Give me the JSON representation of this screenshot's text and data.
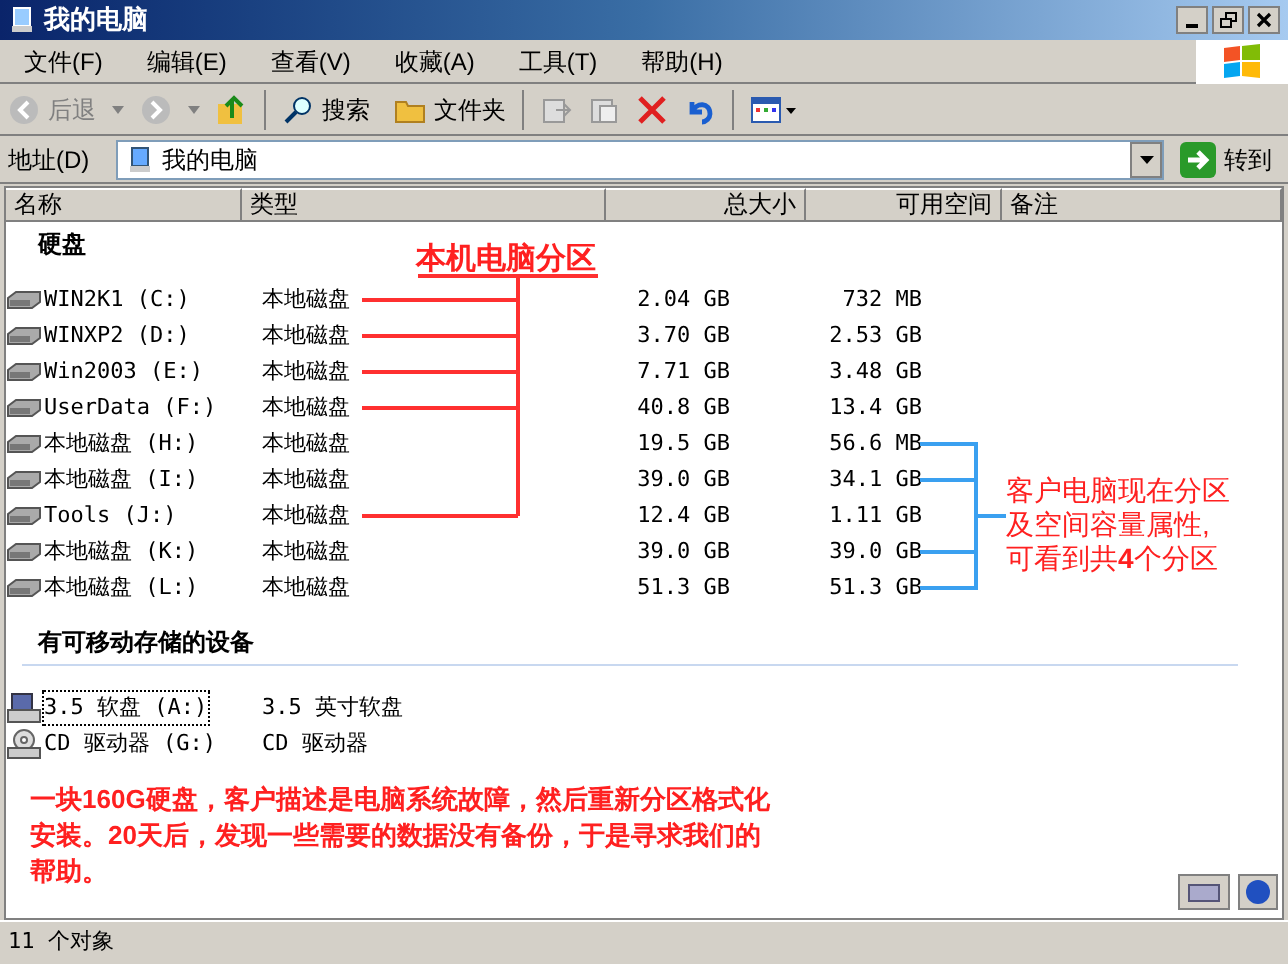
{
  "window": {
    "title": "我的电脑"
  },
  "menu": [
    "文件(F)",
    "编辑(E)",
    "查看(V)",
    "收藏(A)",
    "工具(T)",
    "帮助(H)"
  ],
  "toolbar": {
    "back": "后退",
    "search": "搜索",
    "folders": "文件夹"
  },
  "address": {
    "label": "地址(D)",
    "value": "我的电脑",
    "go": "转到"
  },
  "columns": [
    "名称",
    "类型",
    "总大小",
    "可用空间",
    "备注"
  ],
  "groups": [
    {
      "title": "硬盘",
      "rows": [
        {
          "kind": "hdd",
          "name": "WIN2K1 (C:)",
          "type": "本地磁盘",
          "total": "2.04 GB",
          "free": "732 MB",
          "selected": false
        },
        {
          "kind": "hdd",
          "name": "WINXP2 (D:)",
          "type": "本地磁盘",
          "total": "3.70 GB",
          "free": "2.53 GB",
          "selected": false
        },
        {
          "kind": "hdd",
          "name": "Win2003 (E:)",
          "type": "本地磁盘",
          "total": "7.71 GB",
          "free": "3.48 GB",
          "selected": false
        },
        {
          "kind": "hdd",
          "name": "UserData (F:)",
          "type": "本地磁盘",
          "total": "40.8 GB",
          "free": "13.4 GB",
          "selected": false
        },
        {
          "kind": "hdd",
          "name": "本地磁盘 (H:)",
          "type": "本地磁盘",
          "total": "19.5 GB",
          "free": "56.6 MB",
          "selected": false
        },
        {
          "kind": "hdd",
          "name": "本地磁盘 (I:)",
          "type": "本地磁盘",
          "total": "39.0 GB",
          "free": "34.1 GB",
          "selected": false
        },
        {
          "kind": "hdd",
          "name": "Tools (J:)",
          "type": "本地磁盘",
          "total": "12.4 GB",
          "free": "1.11 GB",
          "selected": false
        },
        {
          "kind": "hdd",
          "name": "本地磁盘 (K:)",
          "type": "本地磁盘",
          "total": "39.0 GB",
          "free": "39.0 GB",
          "selected": false
        },
        {
          "kind": "hdd",
          "name": "本地磁盘 (L:)",
          "type": "本地磁盘",
          "total": "51.3 GB",
          "free": "51.3 GB",
          "selected": false
        }
      ]
    },
    {
      "title": "有可移动存储的设备",
      "rows": [
        {
          "kind": "floppy",
          "name": "3.5 软盘 (A:)",
          "type": "3.5 英寸软盘",
          "selected": true
        },
        {
          "kind": "cd",
          "name": "CD 驱动器 (G:)",
          "type": "CD 驱动器",
          "selected": false
        }
      ]
    }
  ],
  "annotations": {
    "local": "本机电脑分区",
    "client": [
      "客户电脑现在分区",
      "及空间容量属性,",
      "可看到共**4**个分区"
    ],
    "story": "一块**160G**硬盘，客户描述是电脑系统故障，然后重新分区格式化安装。**20**天后，发现一些需要的数据没有备份，于是寻求我们的帮助。"
  },
  "status_bar": "11 个对象"
}
